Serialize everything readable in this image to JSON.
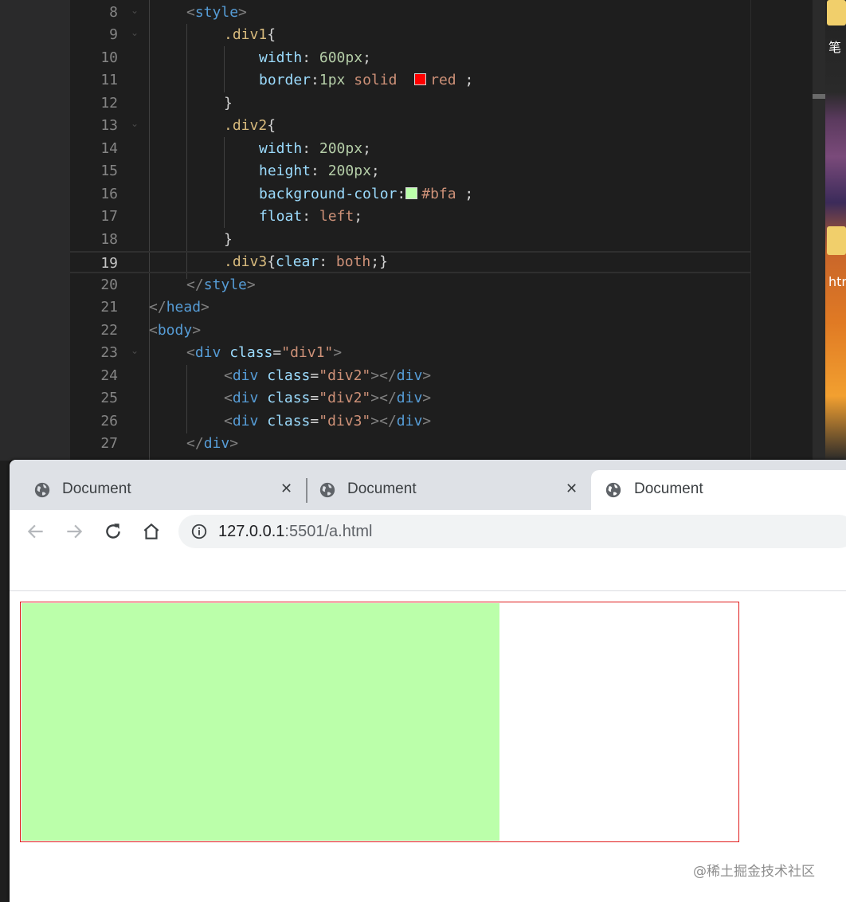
{
  "editor": {
    "lines": [
      {
        "n": "8"
      },
      {
        "n": "9"
      },
      {
        "n": "10"
      },
      {
        "n": "11"
      },
      {
        "n": "12"
      },
      {
        "n": "13"
      },
      {
        "n": "14"
      },
      {
        "n": "15"
      },
      {
        "n": "16"
      },
      {
        "n": "17"
      },
      {
        "n": "18"
      },
      {
        "n": "19"
      },
      {
        "n": "20"
      },
      {
        "n": "21"
      },
      {
        "n": "22"
      },
      {
        "n": "23"
      },
      {
        "n": "24"
      },
      {
        "n": "25"
      },
      {
        "n": "26"
      },
      {
        "n": "27"
      }
    ],
    "current_line": "19",
    "code": {
      "l8": "style",
      "l9_sel": ".div1",
      "l10_prop": "width",
      "l10_val": "600px",
      "l11_prop": "border",
      "l11_num": "1px",
      "l11_kw": "solid",
      "l11_color": "red",
      "l13_sel": ".div2",
      "l14_prop": "width",
      "l14_val": "200px",
      "l15_prop": "height",
      "l15_val": "200px",
      "l16_prop": "background-color",
      "l16_color": "#bfa",
      "l17_prop": "float",
      "l17_val": "left",
      "l19_sel": ".div3",
      "l19_prop": "clear",
      "l19_val": "both",
      "l20": "style",
      "l21": "head",
      "l22": "body",
      "l23_tag": "div",
      "l23_attr": "class",
      "l23_str": "\"div1\"",
      "l24_tag": "div",
      "l24_attr": "class",
      "l24_str": "\"div2\"",
      "l24_close": "div",
      "l25_tag": "div",
      "l25_attr": "class",
      "l25_str": "\"div2\"",
      "l25_close": "div",
      "l26_tag": "div",
      "l26_attr": "class",
      "l26_str": "\"div3\"",
      "l26_close": "div",
      "l27": "div"
    },
    "swatch_colors": {
      "red": "#ff0000",
      "bfa": "#bbffaa"
    }
  },
  "desktop": {
    "text1": "笔",
    "text2": "htr"
  },
  "browser": {
    "tabs": [
      {
        "title": "Document",
        "close": "✕"
      },
      {
        "title": "Document",
        "close": "✕"
      },
      {
        "title": "Document"
      }
    ],
    "active_tab": 2,
    "url_host": "127.0.0.1",
    "url_path": ":5501/a.html",
    "nav_icons": [
      "back-arrow-icon",
      "forward-arrow-icon",
      "reload-icon",
      "home-icon",
      "info-icon"
    ]
  },
  "page": {
    "div1_border_color": "#e01b1b",
    "div2_background": "#bbffaa"
  },
  "watermark": "@稀土掘金技术社区"
}
